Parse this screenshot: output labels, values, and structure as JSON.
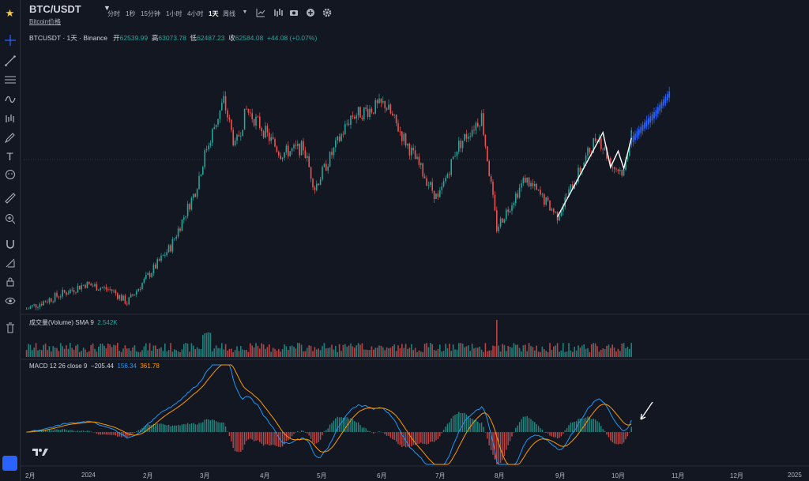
{
  "header": {
    "symbol": "BTC/USDT",
    "subtitle": "Bitcoin价格",
    "timeframes": [
      "分时",
      "1秒",
      "15分钟",
      "1小时",
      "4小时",
      "1天",
      "周线"
    ],
    "active_timeframe": "1天"
  },
  "legend": {
    "name": "BTCUSDT · 1天 · Binance",
    "open_label": "开",
    "open": "62539.99",
    "high_label": "高",
    "high": "63073.78",
    "low_label": "低",
    "low": "62487.23",
    "close_label": "收",
    "close": "62584.08",
    "change": "+44.08 (+0.07%)"
  },
  "volume_legend": {
    "label": "成交量(Volume) SMA 9",
    "value": "2.542K"
  },
  "macd_legend": {
    "label": "MACD 12 26 close 9",
    "hist": "−205.44",
    "macd": "156.34",
    "signal": "361.78"
  },
  "colors": {
    "background": "#131722",
    "up": "#26a69a",
    "down": "#ef5350",
    "projection": "#2962ff",
    "macd_line": "#2196f3",
    "signal_line": "#ff9800",
    "annotation": "#ffffff"
  },
  "chart_data": {
    "type": "candlestick",
    "x_tick_labels": [
      "2月",
      "2024",
      "2月",
      "3月",
      "4月",
      "5月",
      "6月",
      "7月",
      "8月",
      "9月",
      "10月",
      "11月",
      "12月",
      "2025"
    ],
    "price_path": [
      [
        "2023-12-01",
        38000
      ],
      [
        "2024-01-01",
        42000
      ],
      [
        "2024-01-15",
        41000
      ],
      [
        "2024-01-23",
        39000
      ],
      [
        "2024-02-01",
        42500
      ],
      [
        "2024-02-15",
        48000
      ],
      [
        "2024-02-28",
        57000
      ],
      [
        "2024-03-05",
        64000
      ],
      [
        "2024-03-14",
        71500
      ],
      [
        "2024-03-20",
        64000
      ],
      [
        "2024-03-26",
        70000
      ],
      [
        "2024-04-01",
        68000
      ],
      [
        "2024-04-13",
        63000
      ],
      [
        "2024-04-25",
        64000
      ],
      [
        "2024-05-01",
        57500
      ],
      [
        "2024-05-20",
        69000
      ],
      [
        "2024-06-07",
        71000
      ],
      [
        "2024-06-25",
        61000
      ],
      [
        "2024-07-05",
        55500
      ],
      [
        "2024-07-15",
        64000
      ],
      [
        "2024-07-28",
        69000
      ],
      [
        "2024-08-05",
        51000
      ],
      [
        "2024-08-20",
        59000
      ],
      [
        "2024-09-06",
        53000
      ],
      [
        "2024-09-27",
        66000
      ],
      [
        "2024-10-05",
        61000
      ],
      [
        "2024-10-11",
        60000
      ],
      [
        "2024-10-15",
        67000
      ]
    ],
    "projection": {
      "color": "#2962ff",
      "segments": [
        [
          "2024-10-15",
          65000
        ],
        [
          "2024-10-22",
          67500
        ],
        [
          "2024-10-28",
          69500
        ],
        [
          "2024-11-04",
          72500
        ]
      ]
    },
    "drawn_lines": [
      [
        "2024-09-06",
        52800
      ],
      [
        "2024-09-30",
        66400
      ],
      [
        "2024-10-04",
        60800
      ],
      [
        "2024-10-08",
        63400
      ],
      [
        "2024-10-11",
        60600
      ],
      [
        "2024-10-15",
        65500
      ]
    ],
    "macd": {
      "hist_last": -205.44,
      "macd_last": 156.34,
      "signal_last": 361.78
    }
  }
}
